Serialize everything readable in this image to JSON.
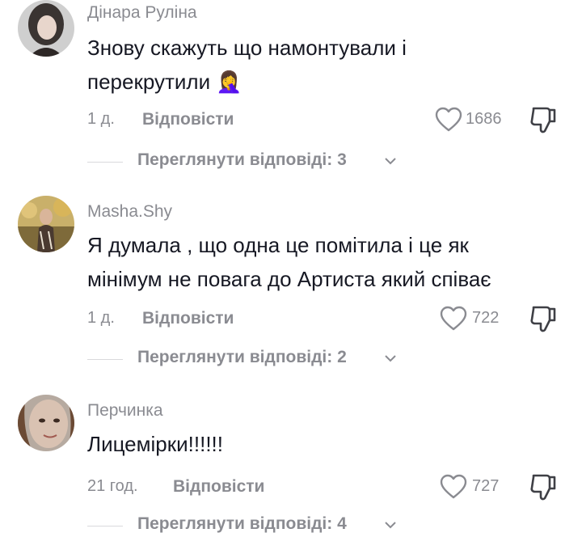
{
  "comments": [
    {
      "username": "Дінара Руліна",
      "text_line1": "Знову скажуть що намонтували і",
      "text_line2": "перекрутили",
      "emoji": "🤦‍♀️",
      "time": "1 д.",
      "reply_label": "Відповісти",
      "likes": "1686",
      "view_replies": "Переглянути відповіді: 3"
    },
    {
      "username": "Masha.Shy",
      "text_line1": "Я думала , що одна це помітила і це як",
      "text_line2": "мінімум не повага до Артиста який співає",
      "time": "1 д.",
      "reply_label": "Відповісти",
      "likes": "722",
      "view_replies": "Переглянути відповіді: 2"
    },
    {
      "username": "Перчинка",
      "text_line1": "Лицемірки!!!!!!",
      "time": "21 год.",
      "reply_label": "Відповісти",
      "likes": "727",
      "view_replies": "Переглянути відповіді: 4"
    }
  ],
  "colors": {
    "text": "#161823",
    "secondary": "#8a8b91",
    "divider": "#d9d9dc"
  },
  "icons": [
    "heart-icon",
    "thumbs-down-icon",
    "chevron-down-icon"
  ]
}
